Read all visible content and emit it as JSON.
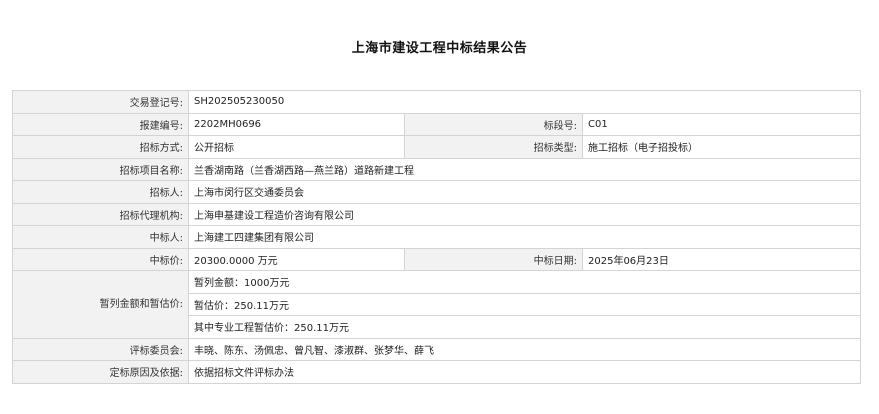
{
  "title": "上海市建设工程中标结果公告",
  "rows": {
    "trade_reg_no": {
      "label": "交易登记号:",
      "value": "SH202505230050"
    },
    "report_no": {
      "label": "报建编号:",
      "value": "2202MH0696"
    },
    "section_no": {
      "label": "标段号:",
      "value": "C01"
    },
    "bid_method": {
      "label": "招标方式:",
      "value": "公开招标"
    },
    "bid_type": {
      "label": "招标类型:",
      "value": "施工招标（电子招投标）"
    },
    "project_name": {
      "label": "招标项目名称:",
      "value": "兰香湖南路（兰香湖西路—燕兰路）道路新建工程"
    },
    "tenderer": {
      "label": "招标人:",
      "value": "上海市闵行区交通委员会"
    },
    "agent": {
      "label": "招标代理机构:",
      "value": "上海申基建设工程造价咨询有限公司"
    },
    "winner": {
      "label": "中标人:",
      "value": "上海建工四建集团有限公司"
    },
    "winning_price": {
      "label": "中标价:",
      "value": "20300.0000 万元"
    },
    "winning_date": {
      "label": "中标日期:",
      "value": "2025年06月23日"
    },
    "provisional": {
      "label": "暂列金额和暂估价:",
      "lines": [
        "暂列金额：1000万元",
        "暂估价：250.11万元",
        "其中专业工程暂估价：250.11万元"
      ]
    },
    "committee": {
      "label": "评标委员会:",
      "value": "丰晓、陈东、汤佩忠、曾凡智、漆淑群、张梦华、薛飞"
    },
    "basis": {
      "label": "定标原因及依据:",
      "value": "依据招标文件评标办法"
    }
  }
}
